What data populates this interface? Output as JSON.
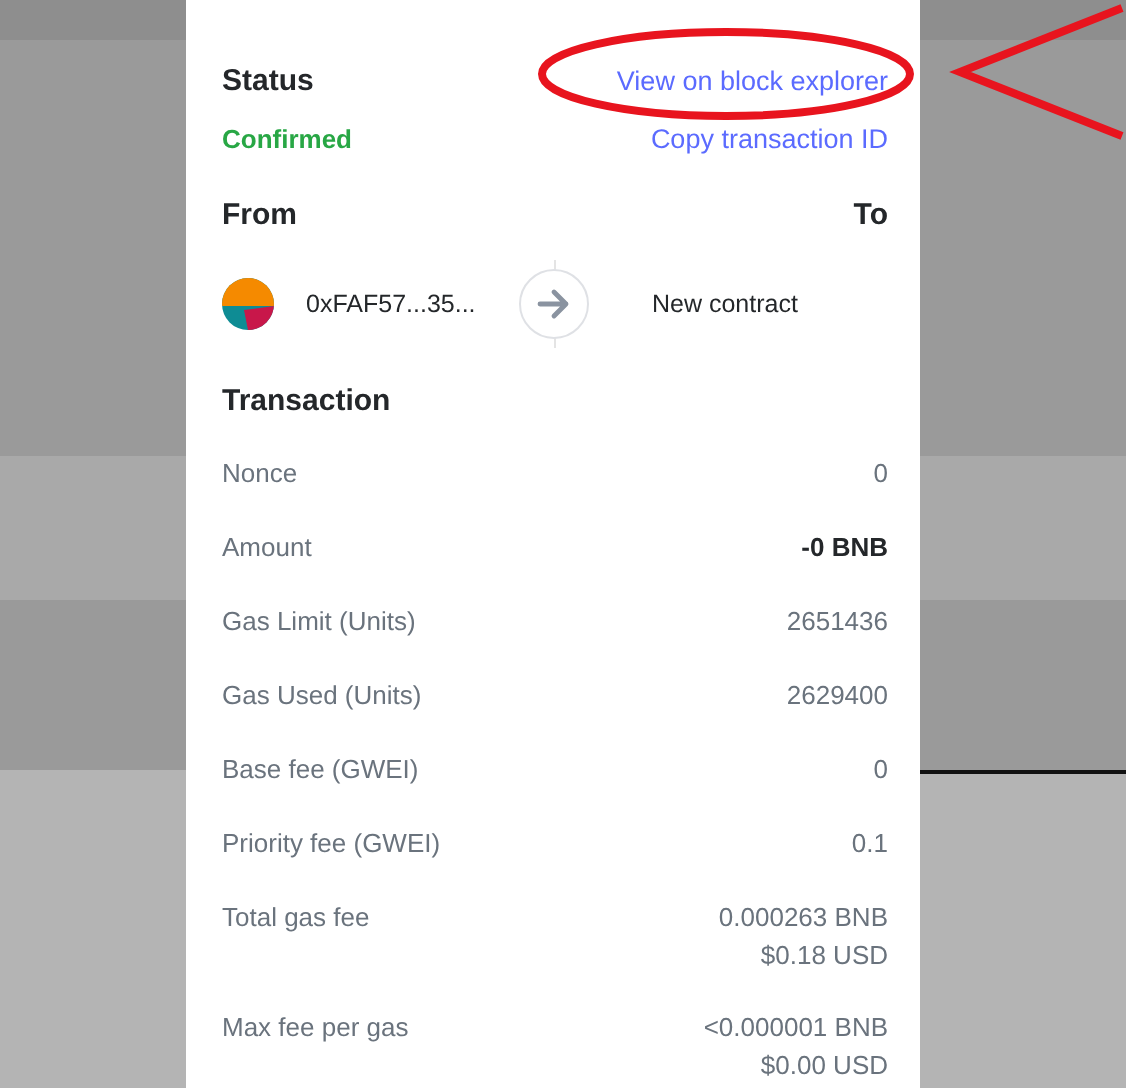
{
  "status": {
    "heading": "Status",
    "value": "Confirmed",
    "links": [
      "View on block explorer",
      "Copy transaction ID"
    ]
  },
  "parties": {
    "from_heading": "From",
    "to_heading": "To",
    "from": "0xFAF57...35...",
    "to": "New contract"
  },
  "transaction": {
    "heading": "Transaction",
    "rows": [
      {
        "label": "Nonce",
        "values": [
          "0"
        ],
        "bold": false
      },
      {
        "label": "Amount",
        "values": [
          "-0 BNB"
        ],
        "bold": true
      },
      {
        "label": "Gas Limit (Units)",
        "values": [
          "2651436"
        ],
        "bold": false
      },
      {
        "label": "Gas Used (Units)",
        "values": [
          "2629400"
        ],
        "bold": false
      },
      {
        "label": "Base fee (GWEI)",
        "values": [
          "0"
        ],
        "bold": false
      },
      {
        "label": "Priority fee (GWEI)",
        "values": [
          "0.1"
        ],
        "bold": false
      },
      {
        "label": "Total gas fee",
        "values": [
          "0.000263 BNB",
          "$0.18 USD"
        ],
        "bold": false
      },
      {
        "label": "Max fee per gas",
        "values": [
          "<0.000001 BNB",
          "$0.00 USD"
        ],
        "bold": false
      }
    ]
  }
}
